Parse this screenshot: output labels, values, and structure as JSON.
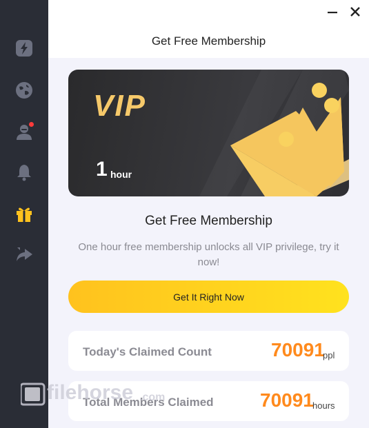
{
  "sidebar": {
    "items": [
      {
        "name": "boost-icon"
      },
      {
        "name": "globe-icon"
      },
      {
        "name": "user-icon",
        "badge": true
      },
      {
        "name": "bell-icon"
      },
      {
        "name": "gift-icon",
        "active": true
      },
      {
        "name": "share-icon"
      }
    ],
    "colors": {
      "icon": "#6c7080",
      "active": "#ffc21e",
      "badge": "#ff3b3b"
    }
  },
  "window": {
    "minimize_icon": "minimize-icon",
    "close_icon": "close-icon"
  },
  "header": {
    "title": "Get Free Membership"
  },
  "vip_card": {
    "brand": "VIP",
    "duration_value": "1",
    "duration_unit": "hour"
  },
  "main": {
    "title": "Get Free Membership",
    "description": "One hour free membership unlocks all VIP privilege, try it now!",
    "cta_label": "Get It Right Now"
  },
  "stats": [
    {
      "label": "Today's Claimed Count",
      "value": "70091",
      "unit": "ppl"
    },
    {
      "label": "Total Members Claimed",
      "value": "70091",
      "unit": "hours"
    }
  ],
  "watermark": {
    "text": "filehorse.com"
  },
  "colors": {
    "accent": "#ffc21e",
    "stat_value": "#ff8a1d",
    "sidebar_bg": "#2a2d36"
  }
}
